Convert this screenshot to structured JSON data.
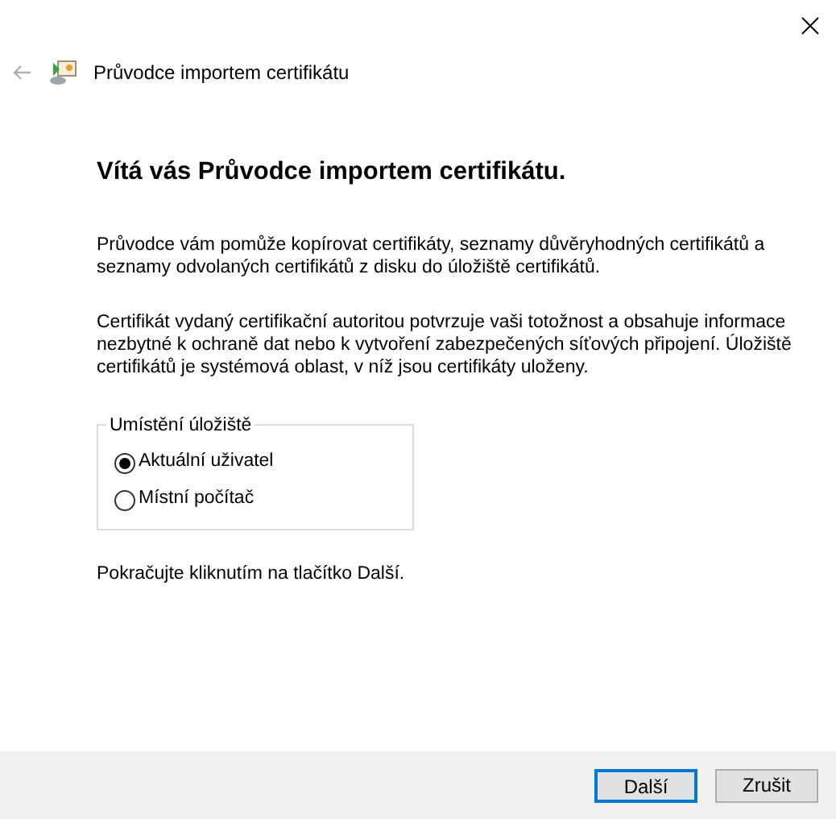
{
  "window": {
    "title": "Průvodce importem certifikátu",
    "back_disabled": true
  },
  "heading": "Vítá vás Průvodce importem certifikátu.",
  "paragraphs": [
    "Průvodce vám pomůže kopírovat certifikáty, seznamy důvěryhodných certifikátů a seznamy odvolaných certifikátů z disku do úložiště certifikátů.",
    "Certifikát vydaný certifikační autoritou potvrzuje vaši totožnost a obsahuje informace nezbytné k ochraně dat nebo k vytvoření zabezpečených síťových připojení. Úložiště certifikátů je systémová oblast, v níž jsou certifikáty uloženy."
  ],
  "store_location": {
    "label": "Umístění úložiště",
    "options": [
      {
        "label": "Aktuální uživatel",
        "selected": true
      },
      {
        "label": "Místní počítač",
        "selected": false
      }
    ]
  },
  "hint": "Pokračujte kliknutím na tlačítko Další.",
  "buttons": [
    {
      "label": "Další",
      "default": true
    },
    {
      "label": "Zrušit",
      "default": false
    }
  ]
}
